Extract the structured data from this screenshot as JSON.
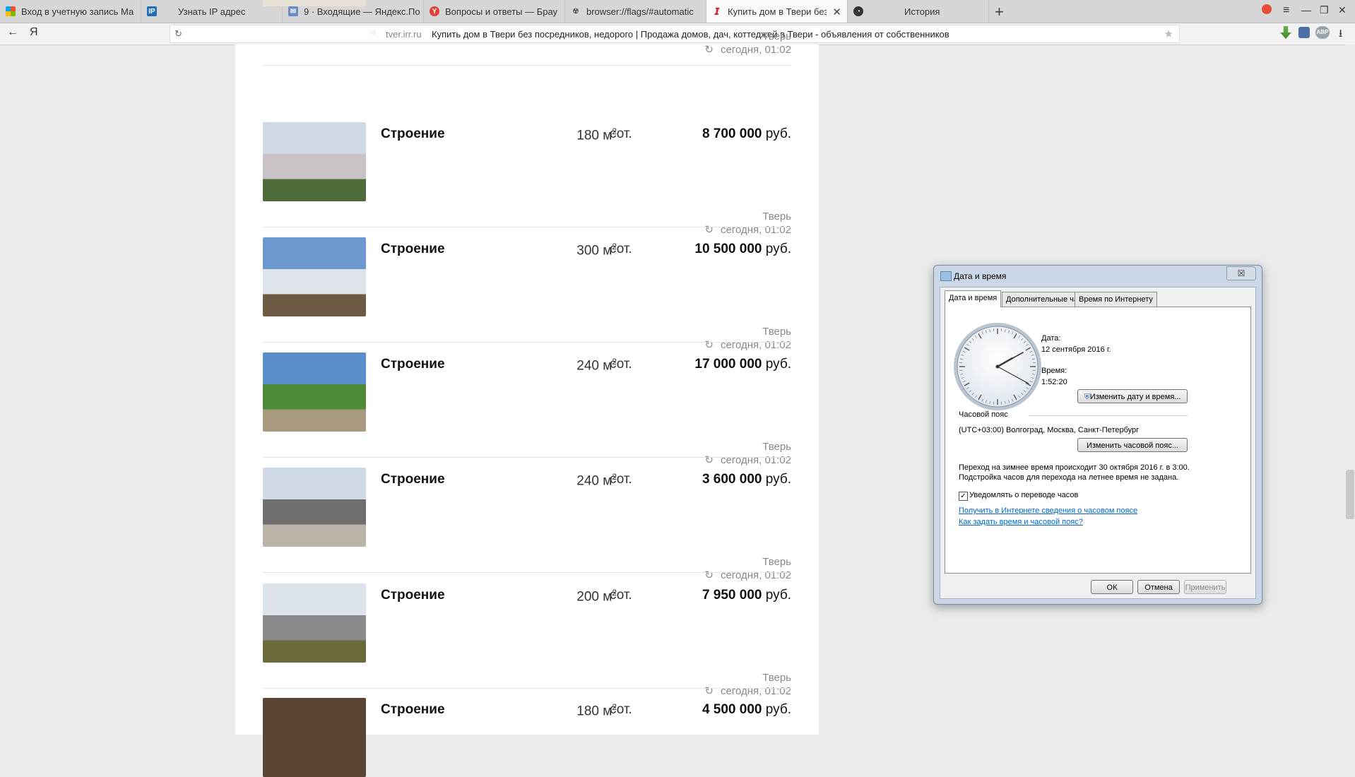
{
  "browser": {
    "tabs": [
      {
        "label": "Вход в учетную запись Ма",
        "icon": "microsoft-icon"
      },
      {
        "label": "Узнать IP адрес",
        "icon": "ip-icon"
      },
      {
        "label": "9 · Входящие — Яндекс.По",
        "icon": "mail-icon"
      },
      {
        "label": "Вопросы и ответы — Брау",
        "icon": "yandex-browser-icon"
      },
      {
        "label": "browser://flags/#automatic",
        "icon": "flags-icon"
      },
      {
        "label": "Купить дом в Твери без",
        "icon": "irr-icon"
      },
      {
        "label": "История",
        "icon": "history-icon"
      }
    ],
    "active_tab": 5,
    "back_label": "←",
    "logo": "Я",
    "url_domain": "tver.irr.ru",
    "page_title": "Купить дом в Твери без посредников, недорого | Продажа домов, дач, коттеджей в Твери - объявления от собственников",
    "extension_badge": "ABP"
  },
  "listings": [
    {
      "name": "",
      "area": "",
      "unit": "",
      "price": "",
      "currency": "",
      "city": "Тверь",
      "date": "сегодня, 01:02",
      "thumb_colors": [
        "#b7cce0",
        "#8a6f55",
        "#e8e2d6"
      ]
    },
    {
      "name": "Строение",
      "area": "180 м",
      "unit": "сот.",
      "price": "8 700 000",
      "currency": "руб.",
      "city": "Тверь",
      "date": "сегодня, 01:02",
      "thumb_colors": [
        "#cfd9e6",
        "#c9c2c7",
        "#4e6b3a"
      ]
    },
    {
      "name": "Строение",
      "area": "300 м",
      "unit": "сот.",
      "price": "10 500 000",
      "currency": "руб.",
      "city": "Тверь",
      "date": "сегодня, 01:02",
      "thumb_colors": [
        "#6d97cf",
        "#dfe3ea",
        "#6e5a45"
      ]
    },
    {
      "name": "Строение",
      "area": "240 м",
      "unit": "сот.",
      "price": "17 000 000",
      "currency": "руб.",
      "city": "Тверь",
      "date": "сегодня, 01:02",
      "thumb_colors": [
        "#5b8fcc",
        "#4f8a39",
        "#a89a7e"
      ]
    },
    {
      "name": "Строение",
      "area": "240 м",
      "unit": "сот.",
      "price": "3 600 000",
      "currency": "руб.",
      "city": "Тверь",
      "date": "сегодня, 01:02",
      "thumb_colors": [
        "#cfdae6",
        "#6e6e6e",
        "#b9b3a8"
      ]
    },
    {
      "name": "Строение",
      "area": "200 м",
      "unit": "сот.",
      "price": "7 950 000",
      "currency": "руб.",
      "city": "Тверь",
      "date": "сегодня, 01:02",
      "thumb_colors": [
        "#dde3ea",
        "#8b8b8b",
        "#6b6a3a"
      ]
    },
    {
      "name": "Строение",
      "area": "180 м",
      "unit": "сот.",
      "price": "4 500 000",
      "currency": "руб.",
      "city": "",
      "date": "",
      "thumb_colors": [
        "#5a4434",
        "#5a4434",
        "#5a4434"
      ]
    }
  ],
  "area_sup": "2",
  "dialog": {
    "title": "Дата и время",
    "close": "☒",
    "tabs": [
      "Дата и время",
      "Дополнительные часы",
      "Время по Интернету"
    ],
    "date_label": "Дата:",
    "date_value": "12 сентября 2016 г.",
    "time_label": "Время:",
    "time_value": "1:52:20",
    "change_datetime_button": "Изменить дату и время...",
    "timezone_label": "Часовой пояс",
    "timezone_value": "(UTC+03:00) Волгоград, Москва, Санкт-Петербург",
    "change_timezone_button": "Изменить часовой пояс...",
    "dst_line1": "Переход на зимнее время происходит 30 октября 2016 г. в 3:00.",
    "dst_line2": "Подстройка часов для перехода на летнее время не задана.",
    "notify_checkbox_label": "Уведомлять о переводе часов",
    "notify_checked": true,
    "link1": "Получить в Интернете сведения о часовом поясе",
    "link2": "Как задать время и часовой пояс?",
    "ok_button": "ОК",
    "cancel_button": "Отмена",
    "apply_button": "Применить"
  }
}
